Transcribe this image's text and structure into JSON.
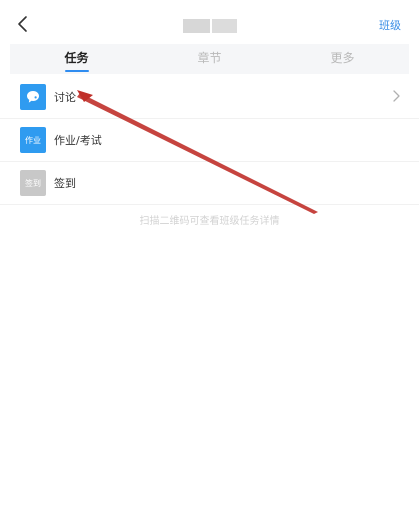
{
  "header": {
    "class_link": "班级"
  },
  "tabs": [
    {
      "label": "任务",
      "active": true
    },
    {
      "label": "章节",
      "active": false
    },
    {
      "label": "更多",
      "active": false
    }
  ],
  "list": [
    {
      "label": "讨论",
      "icon": "chat-bubble-icon",
      "icon_text": ""
    },
    {
      "label": "作业/考试",
      "icon": "homework-icon",
      "icon_text": "作业"
    },
    {
      "label": "签到",
      "icon": "signin-icon",
      "icon_text": "签到"
    }
  ],
  "hint": "扫描二维码可查看班级任务详情",
  "colors": {
    "accent": "#2f8cf0",
    "annotation_arrow": "#c0302a"
  }
}
